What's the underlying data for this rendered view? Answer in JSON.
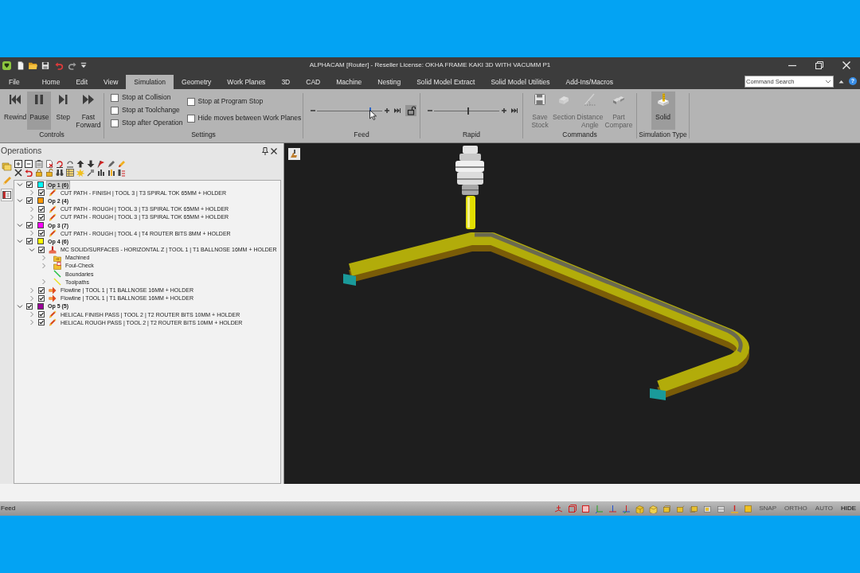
{
  "window": {
    "title": "ALPHACAM [Router] - Reseller License: OKHA FRAME KAKI 3D WITH VACUMM P1"
  },
  "menu_tabs": [
    {
      "label": "File",
      "selected": false
    },
    {
      "label": "Home",
      "selected": false
    },
    {
      "label": "Edit",
      "selected": false
    },
    {
      "label": "View",
      "selected": false
    },
    {
      "label": "Simulation",
      "selected": true
    },
    {
      "label": "Geometry",
      "selected": false
    },
    {
      "label": "Work Planes",
      "selected": false
    },
    {
      "label": "3D",
      "selected": false
    },
    {
      "label": "CAD",
      "selected": false
    },
    {
      "label": "Machine",
      "selected": false
    },
    {
      "label": "Nesting",
      "selected": false
    },
    {
      "label": "Solid Model Extract",
      "selected": false
    },
    {
      "label": "Solid Model Utilities",
      "selected": false
    },
    {
      "label": "Add-Ins/Macros",
      "selected": false
    }
  ],
  "command_search": {
    "placeholder": "Command Search"
  },
  "help_button": {
    "label": "?"
  },
  "ribbon": {
    "groups": [
      {
        "kind": "buttons",
        "label": "Controls",
        "buttons": [
          {
            "label": "Rewind",
            "selected": false,
            "disabled": false
          },
          {
            "label": "Pause",
            "selected": true,
            "disabled": false
          },
          {
            "label": "Step",
            "selected": false,
            "disabled": false
          },
          {
            "label": "Fast Forward",
            "selected": false,
            "disabled": false
          }
        ]
      },
      {
        "kind": "checkboxes",
        "label": "Settings",
        "columns": [
          [
            {
              "label": "Stop at Collision",
              "checked": false
            },
            {
              "label": "Stop at Toolchange",
              "checked": false
            },
            {
              "label": "Stop after Operation",
              "checked": false
            }
          ],
          [
            {
              "label": "Stop at Program Stop",
              "checked": false
            },
            {
              "label": "Hide moves between Work Planes",
              "checked": false
            }
          ]
        ]
      },
      {
        "kind": "slider",
        "label": "Feed",
        "level": 0.82,
        "hovered": true,
        "lock_button": true
      },
      {
        "kind": "slider",
        "label": "Rapid",
        "level": 0.52,
        "hovered": false,
        "lock_button": false
      },
      {
        "kind": "buttons",
        "label": "Commands",
        "buttons": [
          {
            "label": "Save Stock",
            "selected": false,
            "disabled": true
          },
          {
            "label": "Section",
            "selected": false,
            "disabled": true
          },
          {
            "label": "Distance Angle",
            "selected": false,
            "disabled": true
          },
          {
            "label": "Part Compare",
            "selected": false,
            "disabled": true
          }
        ]
      },
      {
        "kind": "buttons",
        "label": "Simulation Type",
        "buttons": [
          {
            "label": "Solid",
            "selected": true,
            "disabled": false
          }
        ]
      }
    ]
  },
  "operations_panel": {
    "title": "Operations",
    "side_tabs": [
      {
        "selected": false
      },
      {
        "selected": false
      },
      {
        "selected": true
      }
    ],
    "tree": [
      {
        "label": "Op 1 (6)",
        "kind": "group",
        "color": "#00ffff",
        "checked": true,
        "expanded": true,
        "selected": true,
        "children": [
          {
            "label": "CUT PATH - FINISH | TOOL 3 | T3 SPIRAL TOK 65MM + HOLDER",
            "kind": "cut",
            "checked": true,
            "expanded": false,
            "selected": false
          }
        ]
      },
      {
        "label": "Op 2 (4)",
        "kind": "group",
        "color": "#ff9900",
        "checked": true,
        "expanded": true,
        "selected": false,
        "children": [
          {
            "label": "CUT PATH - ROUGH | TOOL 3 | T3 SPIRAL TOK 65MM + HOLDER",
            "kind": "cut",
            "checked": true,
            "expanded": false,
            "selected": false
          },
          {
            "label": "CUT PATH - ROUGH | TOOL 3 | T3 SPIRAL TOK 65MM + HOLDER",
            "kind": "cut",
            "checked": true,
            "expanded": false,
            "selected": false
          }
        ]
      },
      {
        "label": "Op 3 (7)",
        "kind": "group",
        "color": "#ff00ff",
        "checked": true,
        "expanded": true,
        "selected": false,
        "children": [
          {
            "label": "CUT PATH - ROUGH | TOOL 4 | T4 ROUTER BITS 8MM + HOLDER",
            "kind": "cut",
            "checked": true,
            "expanded": false,
            "selected": false
          }
        ]
      },
      {
        "label": "Op 4 (6)",
        "kind": "group",
        "color": "#ffff00",
        "checked": true,
        "expanded": true,
        "selected": false,
        "children": [
          {
            "label": "MC SOLID/SURFACES - HORIZONTAL Z | TOOL 1 | T1 BALLNOSE 16MM + HOLDER",
            "kind": "surface",
            "checked": true,
            "expanded": true,
            "selected": false,
            "children": [
              {
                "label": "Machined",
                "kind": "machined",
                "expanded": false,
                "selected": false
              },
              {
                "label": "Foul-Check",
                "kind": "foul-check",
                "expanded": false,
                "selected": false
              },
              {
                "label": "Boundaries",
                "kind": "boundaries",
                "selected": false
              },
              {
                "label": "Toolpaths",
                "kind": "toolpaths",
                "expanded": false,
                "selected": false
              }
            ]
          },
          {
            "label": "Flowline | TOOL 1 | T1 BALLNOSE 16MM + HOLDER",
            "kind": "flowline",
            "checked": true,
            "expanded": false,
            "selected": false
          },
          {
            "label": "Flowline | TOOL 1 | T1 BALLNOSE 16MM + HOLDER",
            "kind": "flowline",
            "checked": true,
            "expanded": false,
            "selected": false
          }
        ]
      },
      {
        "label": "Op 5 (5)",
        "kind": "group",
        "color": "#990099",
        "checked": true,
        "expanded": true,
        "selected": false,
        "children": [
          {
            "label": "HELICAL FINISH PASS | TOOL 2 | T2 ROUTER BITS 10MM + HOLDER",
            "kind": "cut",
            "checked": true,
            "expanded": false,
            "selected": false
          },
          {
            "label": "HELICAL ROUGH PASS | TOOL 2 | T2 ROUTER BITS 10MM + HOLDER",
            "kind": "cut",
            "checked": true,
            "expanded": false,
            "selected": false
          }
        ]
      }
    ]
  },
  "status_bar": {
    "text": "Feed",
    "toggles": [
      {
        "label": "SNAP",
        "on": false
      },
      {
        "label": "ORTHO",
        "on": false
      },
      {
        "label": "AUTO",
        "on": false
      },
      {
        "label": "HIDE",
        "on": true
      }
    ]
  }
}
